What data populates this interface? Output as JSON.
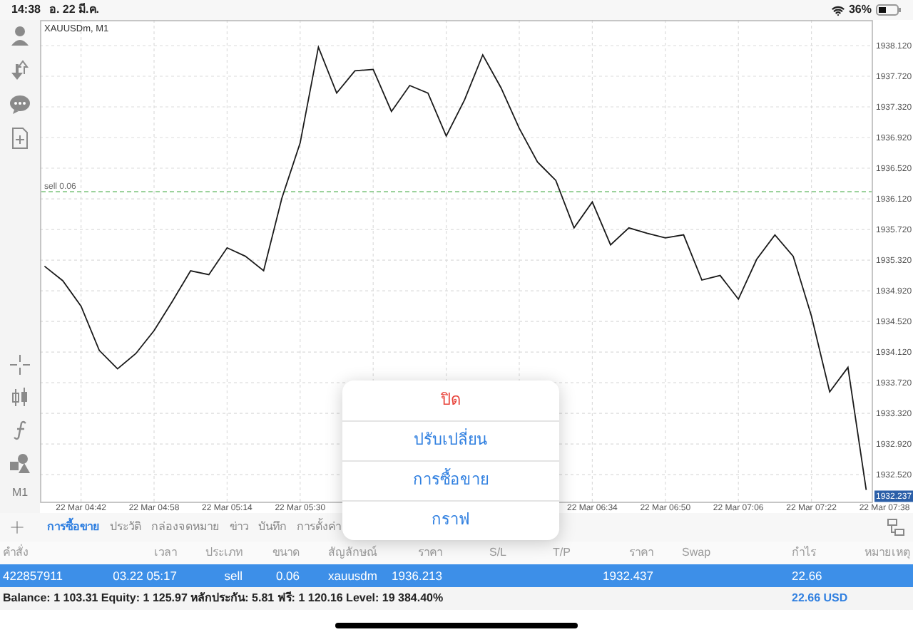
{
  "status_bar": {
    "time": "14:38",
    "date": "อ. 22 มี.ค.",
    "battery": "36%"
  },
  "toolbar": {
    "timeframe": "M1"
  },
  "chart": {
    "title": "XAUUSDm, M1",
    "current_price": "1932.237",
    "chart_data": {
      "type": "line",
      "categories": [
        null,
        null,
        "22 Mar 04:42",
        null,
        null,
        null,
        "22 Mar 04:58",
        null,
        null,
        null,
        "22 Mar 05:14",
        null,
        null,
        null,
        "22 Mar 05:30",
        null,
        null,
        null,
        null,
        null,
        null,
        null,
        null,
        null,
        null,
        null,
        null,
        null,
        null,
        null,
        "22 Mar 06:34",
        null,
        null,
        null,
        "22 Mar 06:50",
        null,
        null,
        null,
        "22 Mar 07:06",
        null,
        null,
        null,
        "22 Mar 07:22",
        null,
        null,
        null,
        "22 Mar 07:38"
      ],
      "series": [
        {
          "color": "#1a1a1a",
          "values": [
            1935.24,
            1935.05,
            1934.72,
            1934.14,
            1933.9,
            1934.1,
            1934.4,
            1934.78,
            1935.18,
            1935.13,
            1935.48,
            1935.37,
            1935.18,
            1936.13,
            1936.85,
            1938.1,
            1937.5,
            1937.79,
            1937.81,
            1937.26,
            1937.6,
            1937.5,
            1936.94,
            1937.41,
            1938.0,
            1937.57,
            1937.04,
            1936.6,
            1936.36,
            1935.74,
            1936.08,
            1935.52,
            1935.74,
            1935.67,
            1935.61,
            1935.65,
            1935.06,
            1935.12,
            1934.81,
            1935.33,
            1935.65,
            1935.37,
            1934.59,
            1933.6,
            1933.92,
            1932.32,
            null
          ]
        }
      ],
      "ylim": [
        1932.167,
        1938.455
      ],
      "yticks": [
        {
          "value": 1932.52,
          "label": "1932.520"
        },
        {
          "value": 1932.92,
          "label": "1932.920"
        },
        {
          "value": 1933.32,
          "label": "1933.320"
        },
        {
          "value": 1933.72,
          "label": "1933.720"
        },
        {
          "value": 1934.12,
          "label": "1934.120"
        },
        {
          "value": 1934.52,
          "label": "1934.520"
        },
        {
          "value": 1934.92,
          "label": "1934.920"
        },
        {
          "value": 1935.32,
          "label": "1935.320"
        },
        {
          "value": 1935.72,
          "label": "1935.720"
        },
        {
          "value": 1936.12,
          "label": "1936.120"
        },
        {
          "value": 1936.52,
          "label": "1936.520"
        },
        {
          "value": 1936.92,
          "label": "1936.920"
        },
        {
          "value": 1937.32,
          "label": "1937.320"
        },
        {
          "value": 1937.72,
          "label": "1937.720"
        },
        {
          "value": 1938.12,
          "label": "1938.120"
        }
      ],
      "grid": true,
      "ref_lines": [
        {
          "axis": "y",
          "value": 1936.213,
          "label": "sell 0.06",
          "color": "#7cc47c"
        }
      ]
    }
  },
  "tabs": [
    {
      "label": "การซื้อขาย",
      "selected": true
    },
    {
      "label": "ประวัติ",
      "selected": false
    },
    {
      "label": "กล่องจดหมาย",
      "selected": false
    },
    {
      "label": "ข่าว",
      "selected": false
    },
    {
      "label": "บันทึก",
      "selected": false
    },
    {
      "label": "การตั้งค่า",
      "selected": false
    }
  ],
  "table": {
    "columns": [
      "คำสั่ง",
      "เวลา",
      "ประเภท",
      "ขนาด",
      "สัญลักษณ์",
      "ราคา",
      "S/L",
      "T/P",
      "ราคา",
      "Swap",
      "กำไร",
      "หมายเหตุ"
    ],
    "rows": [
      {
        "selected": true,
        "order": "422857911",
        "time": "03.22 05:17",
        "type": "sell",
        "volume": "0.06",
        "symbol": "xauusdm",
        "open_price": "1936.213",
        "price": "1932.437",
        "profit": "22.66"
      }
    ],
    "summary": "Balance: 1 103.31 Equity: 1 125.97 หลักประกัน: 5.81 ฟรี: 1 120.16 Level: 19 384.40%",
    "summary_profit": "22.66 USD"
  },
  "popup_menu": {
    "items": [
      {
        "label": "ปิด",
        "kind": "destructive"
      },
      {
        "label": "ปรับเปลี่ยน",
        "kind": "default"
      },
      {
        "label": "การซื้อขาย",
        "kind": "default"
      },
      {
        "label": "กราฟ",
        "kind": "default"
      }
    ]
  }
}
